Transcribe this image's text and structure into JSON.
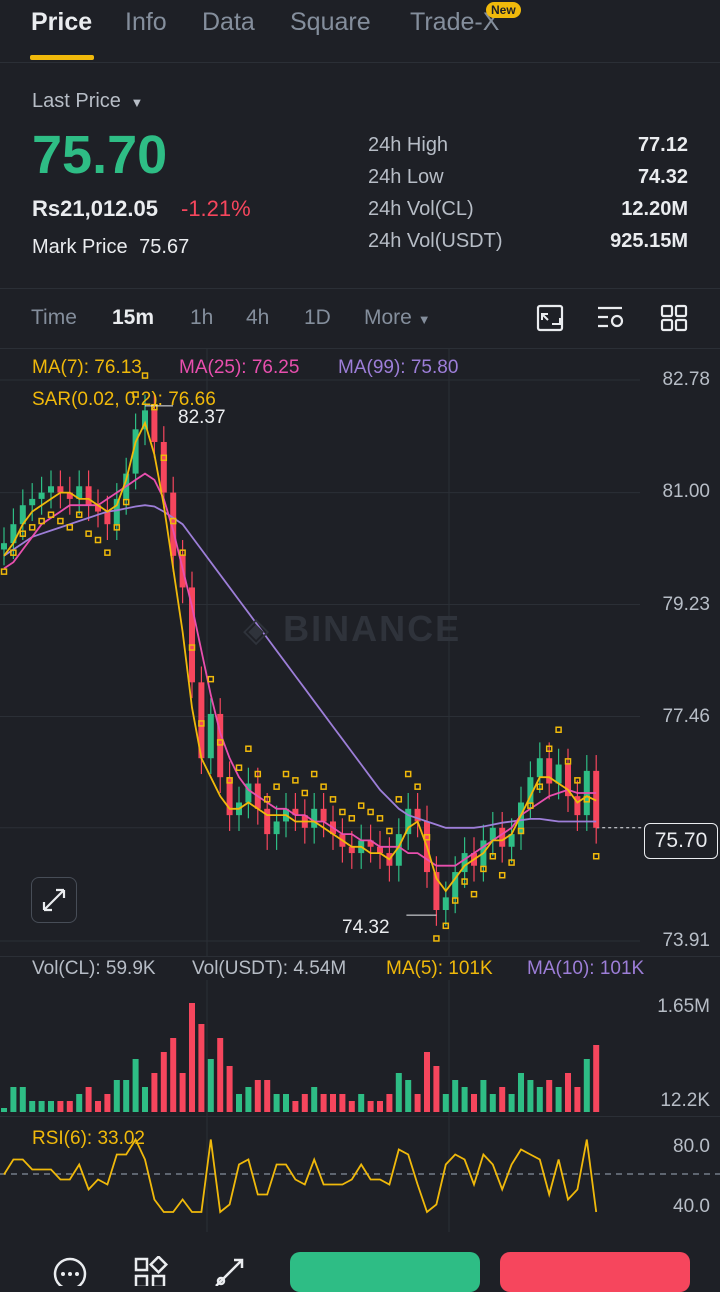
{
  "tabs": [
    {
      "label": "Price"
    },
    {
      "label": "Info"
    },
    {
      "label": "Data"
    },
    {
      "label": "Square"
    },
    {
      "label": "Trade-X"
    }
  ],
  "new_badge": "New",
  "price": {
    "last_price_label": "Last Price",
    "last_price": "75.70",
    "fiat": "Rs21,012.05",
    "change": "-1.21%",
    "mark_label": "Mark Price",
    "mark_value": "75.67"
  },
  "stats": [
    {
      "label": "24h High",
      "value": "77.12"
    },
    {
      "label": "24h Low",
      "value": "74.32"
    },
    {
      "label": "24h Vol(CL)",
      "value": "12.20M"
    },
    {
      "label": "24h Vol(USDT)",
      "value": "925.15M"
    }
  ],
  "intervals": [
    {
      "label": "Time"
    },
    {
      "label": "15m"
    },
    {
      "label": "1h"
    },
    {
      "label": "4h"
    },
    {
      "label": "1D"
    },
    {
      "label": "More"
    }
  ],
  "indicators": {
    "ma7": "MA(7): 76.13",
    "ma25": "MA(25): 76.25",
    "ma99": "MA(99): 75.80",
    "sar": "SAR(0.02, 0.2): 76.66",
    "vol_cl": "Vol(CL): 59.9K",
    "vol_usdt": "Vol(USDT): 4.54M",
    "vol_ma5": "MA(5): 101K",
    "vol_ma10": "MA(10): 101K",
    "rsi": "RSI(6): 33.02"
  },
  "watermark": "BINANCE",
  "colors": {
    "up": "#2ebd85",
    "down": "#f6465d",
    "ma7": "#f0b90b",
    "ma25": "#e84fae",
    "ma99": "#9d7ed8",
    "sar": "#f0b90b",
    "bg": "#1e2026"
  },
  "chart_data": {
    "type": "candlestick",
    "interval": "15m",
    "y_axis_ticks": [
      "82.78",
      "81.00",
      "79.23",
      "77.46",
      "75.70",
      "73.91"
    ],
    "high_marker": "82.37",
    "low_marker": "74.32",
    "current_price": "75.70",
    "ylim": [
      73.91,
      82.78
    ],
    "close": [
      80.2,
      80.5,
      80.8,
      80.9,
      81.0,
      81.1,
      81.0,
      80.9,
      81.1,
      80.8,
      80.7,
      80.5,
      80.9,
      81.3,
      82.0,
      82.3,
      81.8,
      81.0,
      80.0,
      79.5,
      78.0,
      76.8,
      77.5,
      76.5,
      75.9,
      76.1,
      76.4,
      76.0,
      75.6,
      75.8,
      76.0,
      75.9,
      75.7,
      76.0,
      75.8,
      75.6,
      75.4,
      75.3,
      75.5,
      75.4,
      75.3,
      75.1,
      75.6,
      76.0,
      75.8,
      75.0,
      74.4,
      74.6,
      75.0,
      75.3,
      75.1,
      75.5,
      75.7,
      75.4,
      75.6,
      76.1,
      76.5,
      76.8,
      76.4,
      76.7,
      76.2,
      75.9,
      76.6,
      75.7
    ],
    "ma7": [
      80.0,
      80.2,
      80.5,
      80.7,
      80.8,
      80.9,
      81.0,
      81.0,
      80.9,
      80.9,
      80.8,
      80.7,
      80.8,
      81.2,
      81.8,
      82.1,
      81.6,
      80.8,
      79.8,
      78.8,
      77.6,
      76.8,
      76.5,
      76.2,
      76.0,
      76.0,
      76.1,
      76.0,
      75.9,
      75.9,
      75.9,
      75.8,
      75.8,
      75.8,
      75.7,
      75.6,
      75.5,
      75.4,
      75.4,
      75.3,
      75.3,
      75.2,
      75.4,
      75.7,
      75.8,
      75.4,
      74.9,
      74.7,
      74.9,
      75.1,
      75.2,
      75.3,
      75.5,
      75.5,
      75.6,
      75.9,
      76.2,
      76.5,
      76.5,
      76.4,
      76.3,
      76.1,
      76.2,
      76.13
    ],
    "ma25": [
      79.8,
      79.9,
      80.1,
      80.3,
      80.5,
      80.6,
      80.7,
      80.8,
      80.8,
      80.8,
      80.8,
      80.9,
      81.0,
      81.1,
      81.2,
      81.3,
      81.2,
      80.9,
      80.4,
      79.8,
      79.2,
      78.5,
      77.8,
      77.2,
      76.8,
      76.5,
      76.3,
      76.2,
      76.1,
      76.0,
      76.0,
      75.9,
      75.9,
      75.8,
      75.8,
      75.7,
      75.6,
      75.6,
      75.5,
      75.5,
      75.4,
      75.4,
      75.4,
      75.3,
      75.3,
      75.2,
      75.1,
      75.1,
      75.1,
      75.2,
      75.3,
      75.4,
      75.5,
      75.6,
      75.7,
      75.9,
      76.0,
      76.1,
      76.2,
      76.25,
      76.3,
      76.25,
      76.25,
      76.25
    ],
    "ma99": [
      80.0,
      80.1,
      80.2,
      80.3,
      80.35,
      80.4,
      80.45,
      80.5,
      80.55,
      80.6,
      80.65,
      80.7,
      80.72,
      80.75,
      80.78,
      80.8,
      80.78,
      80.7,
      80.6,
      80.5,
      80.3,
      80.1,
      79.9,
      79.7,
      79.5,
      79.3,
      79.1,
      78.9,
      78.7,
      78.5,
      78.3,
      78.1,
      77.9,
      77.7,
      77.5,
      77.3,
      77.1,
      76.9,
      76.7,
      76.5,
      76.3,
      76.15,
      76.0,
      75.9,
      75.85,
      75.8,
      75.75,
      75.7,
      75.7,
      75.7,
      75.7,
      75.72,
      75.75,
      75.78,
      75.8,
      75.82,
      75.84,
      75.84,
      75.82,
      75.8,
      75.8,
      75.8,
      75.8,
      75.8
    ],
    "rsi_ticks": [
      "80.0",
      "40.0"
    ],
    "volume_ticks": [
      "1.65M",
      "12.2K"
    ]
  },
  "nav": {
    "more_icon": "more-icon",
    "grid_icon": "grid-icon",
    "tool_icon": "draw-tool-icon"
  }
}
